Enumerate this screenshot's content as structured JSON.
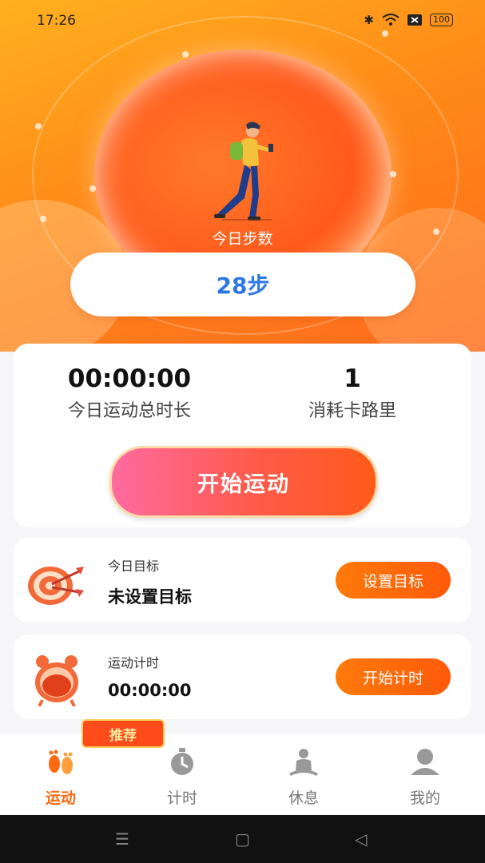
{
  "status_bar": {
    "time": "17:26",
    "bluetooth_icon": "bluetooth-icon",
    "wifi_icon": "wifi-icon",
    "battery_level": "100"
  },
  "hero": {
    "label": "今日步数",
    "steps": "28步",
    "accent_color": "#2e78e6"
  },
  "stats": {
    "duration_value": "00:00:00",
    "duration_label": "今日运动总时长",
    "calories_value": "1",
    "calories_label": "消耗卡路里",
    "start_button": "开始运动"
  },
  "goal_card": {
    "title": "今日目标",
    "value": "未设置目标",
    "button": "设置目标"
  },
  "timer_card": {
    "title": "运动计时",
    "value": "00:00:00",
    "button": "开始计时"
  },
  "tabbar": {
    "badge": "推荐",
    "tabs": [
      {
        "label": "运动",
        "icon": "footprints-icon",
        "active": true
      },
      {
        "label": "计时",
        "icon": "stopwatch-icon",
        "active": false
      },
      {
        "label": "休息",
        "icon": "meditation-icon",
        "active": false
      },
      {
        "label": "我的",
        "icon": "profile-icon",
        "active": false
      }
    ]
  },
  "nav": {
    "menu_icon": "☰",
    "home_icon": "▢",
    "back_icon": "◁"
  }
}
